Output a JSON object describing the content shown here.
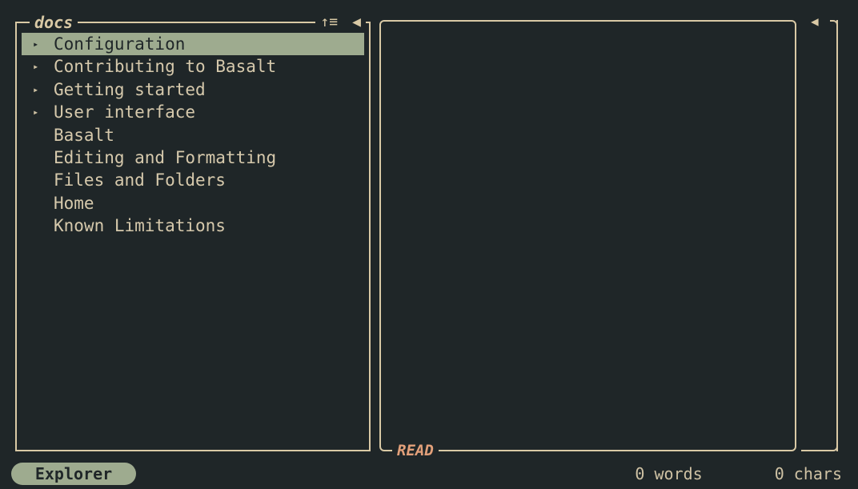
{
  "explorer": {
    "title": "docs",
    "sort_icon": "↑≡",
    "collapse_icon": "◀",
    "items": [
      {
        "label": "Configuration",
        "folder": true,
        "selected": true
      },
      {
        "label": "Contributing to Basalt",
        "folder": true
      },
      {
        "label": "Getting started",
        "folder": true
      },
      {
        "label": "User interface",
        "folder": true
      },
      {
        "label": "Basalt",
        "folder": false
      },
      {
        "label": "Editing and Formatting",
        "folder": false
      },
      {
        "label": "Files and Folders",
        "folder": false
      },
      {
        "label": "Home",
        "folder": false
      },
      {
        "label": "Known Limitations",
        "folder": false
      }
    ],
    "folder_arrow": "▸"
  },
  "editor": {
    "mode": "READ"
  },
  "outline": {
    "toggle_icon": "◀"
  },
  "statusbar": {
    "pane": "Explorer",
    "words": "0 words",
    "chars": "0 chars"
  }
}
